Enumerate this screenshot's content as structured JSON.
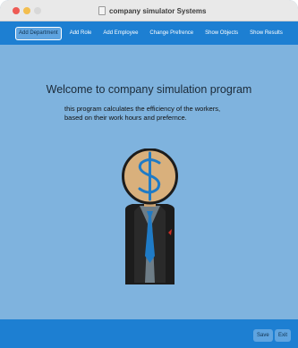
{
  "window": {
    "title": "company simulator Systems"
  },
  "toolbar": {
    "items": [
      {
        "label": "Add Department",
        "active": true
      },
      {
        "label": "Add Role",
        "active": false
      },
      {
        "label": "Add Employee",
        "active": false
      },
      {
        "label": "Change Prefrence",
        "active": false
      },
      {
        "label": "Show Objects",
        "active": false
      },
      {
        "label": "Show Results",
        "active": false
      }
    ]
  },
  "main": {
    "welcome": "Welcome to company simulation program",
    "description_line1": "this program calculates the efficiency of the workers,",
    "description_line2": "based on their work hours and prefernce."
  },
  "footer": {
    "save_label": "Save",
    "exit_label": "Exit"
  },
  "colors": {
    "background": "#7fb3de",
    "bar": "#1d7fd2",
    "button_active": "#5fa4e0"
  },
  "icons": {
    "mascot": "businessman-dollar-head-icon"
  }
}
